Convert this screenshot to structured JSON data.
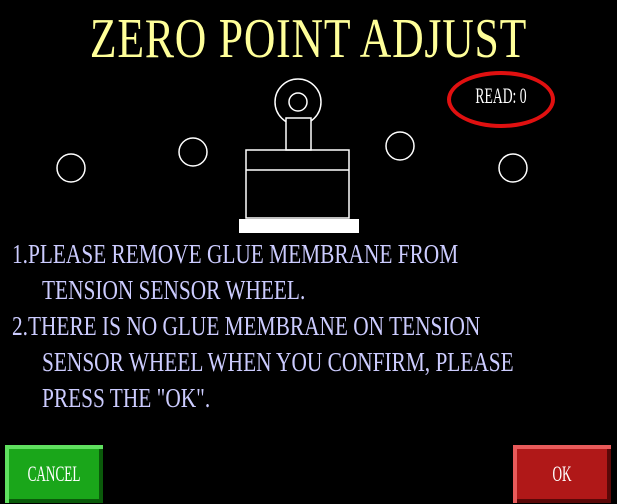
{
  "screen": {
    "title": "ZERO POINT ADJUST",
    "read_label": "READ:",
    "read_value": "0",
    "read_display": "READ: 0",
    "instructions": [
      "1.PLEASE REMOVE GLUE MEMBRANE FROM",
      "TENSION SENSOR WHEEL.",
      "2.THERE IS NO GLUE MEMBRANE ON TENSION",
      "SENSOR WHEEL WHEN YOU CONFIRM, PLEASE",
      "PRESS THE \"OK\"."
    ]
  },
  "buttons": {
    "cancel_label": "CANCEL",
    "ok_label": "OK"
  },
  "colors": {
    "background": "#000000",
    "title": "#ffff99",
    "instruction_text": "#ccccff",
    "read_highlight": "#e01010",
    "cancel_button": "#1aa61a",
    "ok_button": "#b01818"
  },
  "icons": {
    "diagram": "tension-sensor-wheel-diagram"
  }
}
